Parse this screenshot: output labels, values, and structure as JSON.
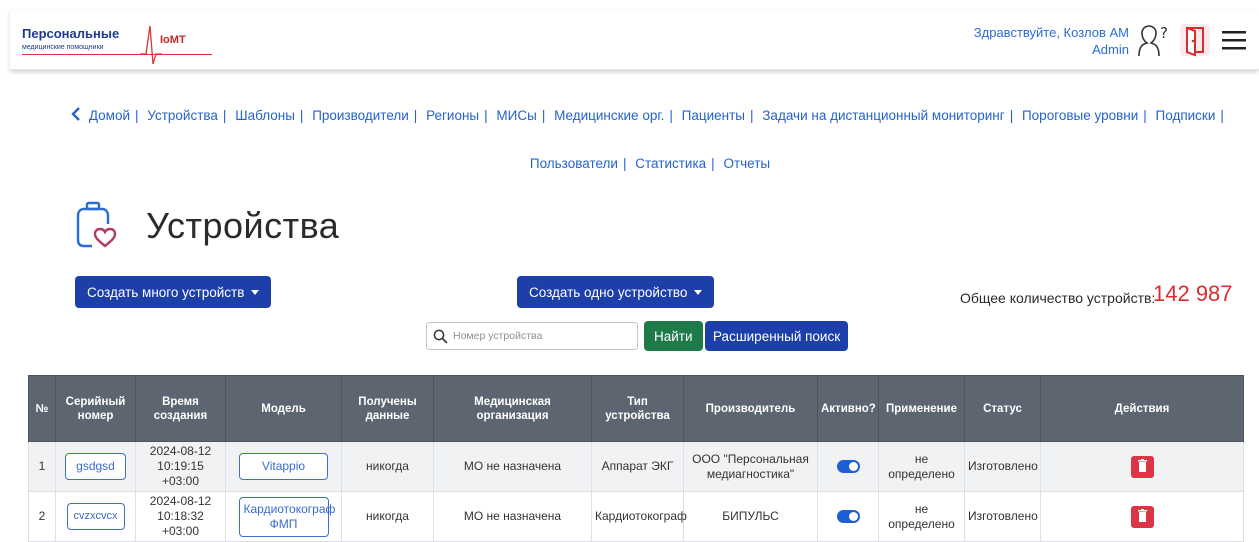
{
  "header": {
    "logo_title": "Персональные",
    "logo_subtitle": "медицинские помощники",
    "logo_brand": "IoMT",
    "greeting": "Здравствуйте, Козлов АМ",
    "role": "Admin",
    "icons": [
      "help-user-icon",
      "logout-door-icon",
      "hamburger-menu-icon"
    ]
  },
  "nav": {
    "items": [
      "Домой",
      "Устройства",
      "Шаблоны",
      "Производители",
      "Регионы",
      "МИСы",
      "Медицинские орг.",
      "Пациенты",
      "Задачи на дистанционный мониторинг",
      "Пороговые уровни",
      "Подписки",
      "Пользователи",
      "Статистика",
      "Отчеты"
    ]
  },
  "page": {
    "title": "Устройства"
  },
  "toolbar": {
    "create_many": "Создать много устройств",
    "create_one": "Создать одно устройство",
    "total_label": "Общее количество устройств:",
    "total_value": "142 987",
    "search_placeholder": "Номер устройства",
    "find": "Найти",
    "advanced": "Расширенный поиск"
  },
  "table": {
    "headers": [
      "№",
      "Серийный номер",
      "Время создания",
      "Модель",
      "Получены данные",
      "Медицинская организация",
      "Тип устройства",
      "Производитель",
      "Активно?",
      "Применение",
      "Статус",
      "Действия"
    ],
    "rows": [
      {
        "n": "1",
        "serial": "gsdgsd",
        "created_date": "2024-08-12",
        "created_time": "10:19:15 +03:00",
        "model": "Vitappio",
        "received": "никогда",
        "org": "МО не назначена",
        "type": "Аппарат ЭКГ",
        "manufacturer": "ООО \"Персональная медиагностика\"",
        "active": true,
        "usage": "не определено",
        "status": "Изготовлено"
      },
      {
        "n": "2",
        "serial": "cvzxcvcx",
        "created_date": "2024-08-12",
        "created_time": "10:18:32 +03:00",
        "model": "Кардиотокограф ФМП",
        "received": "никогда",
        "org": "МО не назначена",
        "type": "Кардиотокограф",
        "manufacturer": "БИПУЛЬС",
        "active": true,
        "usage": "не определено",
        "status": "Изготовлено"
      }
    ]
  },
  "colors": {
    "primary": "#1c3faa",
    "success": "#1f7a4a",
    "danger": "#dc3545",
    "link": "#2563c9",
    "table_header": "#5d6670"
  }
}
